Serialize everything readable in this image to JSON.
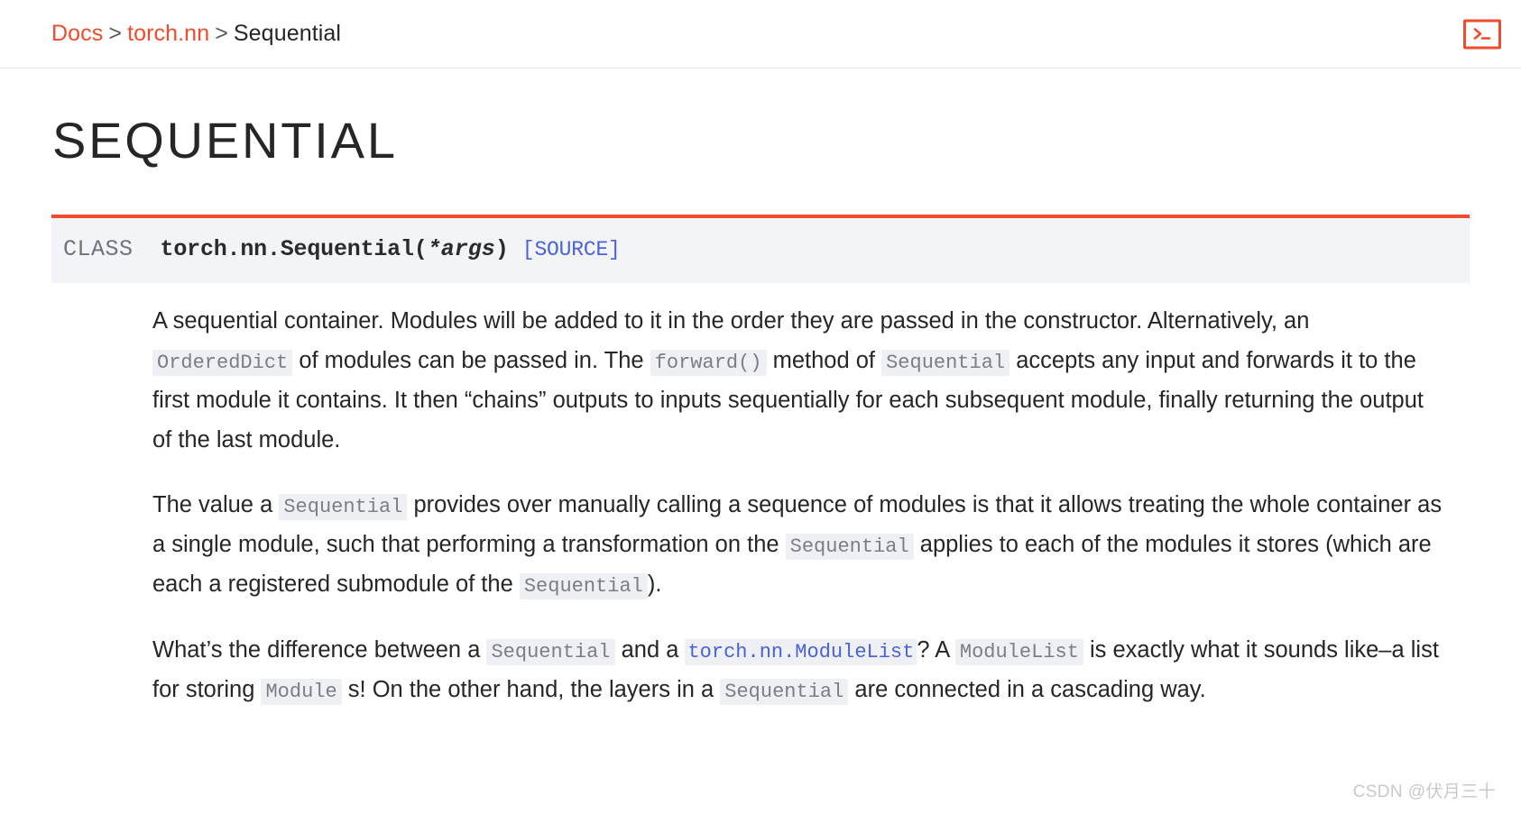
{
  "breadcrumb": {
    "docs": "Docs",
    "sep1": ">",
    "module": "torch.nn",
    "sep2": ">",
    "current": "Sequential"
  },
  "header": {
    "terminal_icon": "terminal-icon",
    "accent_color": "#ee4c2c"
  },
  "page": {
    "title": "SEQUENTIAL"
  },
  "signature": {
    "keyword": "CLASS",
    "qualname": "torch.nn.Sequential",
    "open_paren": "(",
    "args": "*args",
    "close_paren": ")",
    "source_link": "[SOURCE]",
    "accent_bar_color": "#ee4c2c",
    "background_color": "#f3f4f7",
    "source_link_color": "#4a62d8"
  },
  "paragraphs": {
    "p1": {
      "t1": "A sequential container. Modules will be added to it in the order they are passed in the constructor. Alternatively, an ",
      "c1": "OrderedDict",
      "t2": " of modules can be passed in. The ",
      "c2": "forward()",
      "t3": " method of ",
      "c3": "Sequential",
      "t4": " accepts any input and forwards it to the first module it contains. It then “chains” outputs to inputs sequentially for each subsequent module, finally returning the output of the last module."
    },
    "p2": {
      "t1": "The value a ",
      "c1": "Sequential",
      "t2": " provides over manually calling a sequence of modules is that it allows treating the whole container as a single module, such that performing a transformation on the ",
      "c2": "Sequential",
      "t3": " applies to each of the modules it stores (which are each a registered submodule of the ",
      "c3": "Sequential",
      "t4": ")."
    },
    "p3": {
      "t1": "What’s the difference between a ",
      "c1": "Sequential",
      "t2": " and a ",
      "link": "torch.nn.ModuleList",
      "t3": "? A ",
      "c2": "ModuleList",
      "t4": " is exactly what it sounds like–a list for storing ",
      "c3": "Module",
      "t5": " s! On the other hand, the layers in a ",
      "c4": "Sequential",
      "t6": " are connected in a cascading way."
    }
  },
  "watermark": {
    "text": "CSDN @伏月三十"
  }
}
